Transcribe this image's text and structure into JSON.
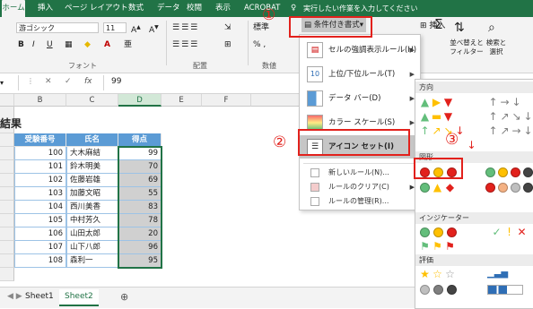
{
  "ribbon_tabs": [
    "ホーム",
    "挿入",
    "ページ レイアウト",
    "数式",
    "データ",
    "校閲",
    "表示",
    "ACROBAT"
  ],
  "tellme": "実行したい作業を入力してください",
  "font": {
    "name": "游ゴシック",
    "size": "11",
    "bold": "B",
    "italic": "I",
    "underline": "U",
    "group_label": "フォント"
  },
  "align_group_label": "配置",
  "number": {
    "format": "標準",
    "group_label": "数値"
  },
  "conditional_button": "条件付き書式",
  "right_ribbon": {
    "insert": "挿入",
    "sort_filter": "並べ替えと フィルター",
    "find_select": "検索と 選択",
    "sum": "Σ"
  },
  "formula": {
    "cancel": "✕",
    "enter": "✓",
    "fx": "fx",
    "value": "99"
  },
  "columns": [
    "B",
    "C",
    "D",
    "E",
    "F"
  ],
  "title_cell": "結果",
  "table": {
    "headers": [
      "受験番号",
      "氏名",
      "得点"
    ],
    "rows": [
      [
        "100",
        "大木麻結",
        "99"
      ],
      [
        "101",
        "鈴木明美",
        "70"
      ],
      [
        "102",
        "佐藤岩雄",
        "69"
      ],
      [
        "103",
        "加藤文昭",
        "55"
      ],
      [
        "104",
        "西川美香",
        "83"
      ],
      [
        "105",
        "中村芳久",
        "78"
      ],
      [
        "106",
        "山田太郎",
        "20"
      ],
      [
        "107",
        "山下八郎",
        "96"
      ],
      [
        "108",
        "森利一",
        "95"
      ]
    ]
  },
  "sheets": [
    "Sheet1",
    "Sheet2"
  ],
  "menu": {
    "items": [
      "セルの強調表示ルール(H)",
      "上位/下位ルール(T)",
      "データ バー(D)",
      "カラー スケール(S)",
      "アイコン セット(I)"
    ],
    "small": [
      "新しいルール(N)...",
      "ルールのクリア(C)",
      "ルールの管理(R)..."
    ]
  },
  "submenu": {
    "sections": [
      "方向",
      "図形",
      "インジケーター",
      "評価"
    ]
  },
  "callouts": [
    "①",
    "②",
    "③"
  ],
  "colors": {
    "excel_green": "#217346",
    "table_blue": "#5b9bd5",
    "callout_red": "#e2211c"
  }
}
